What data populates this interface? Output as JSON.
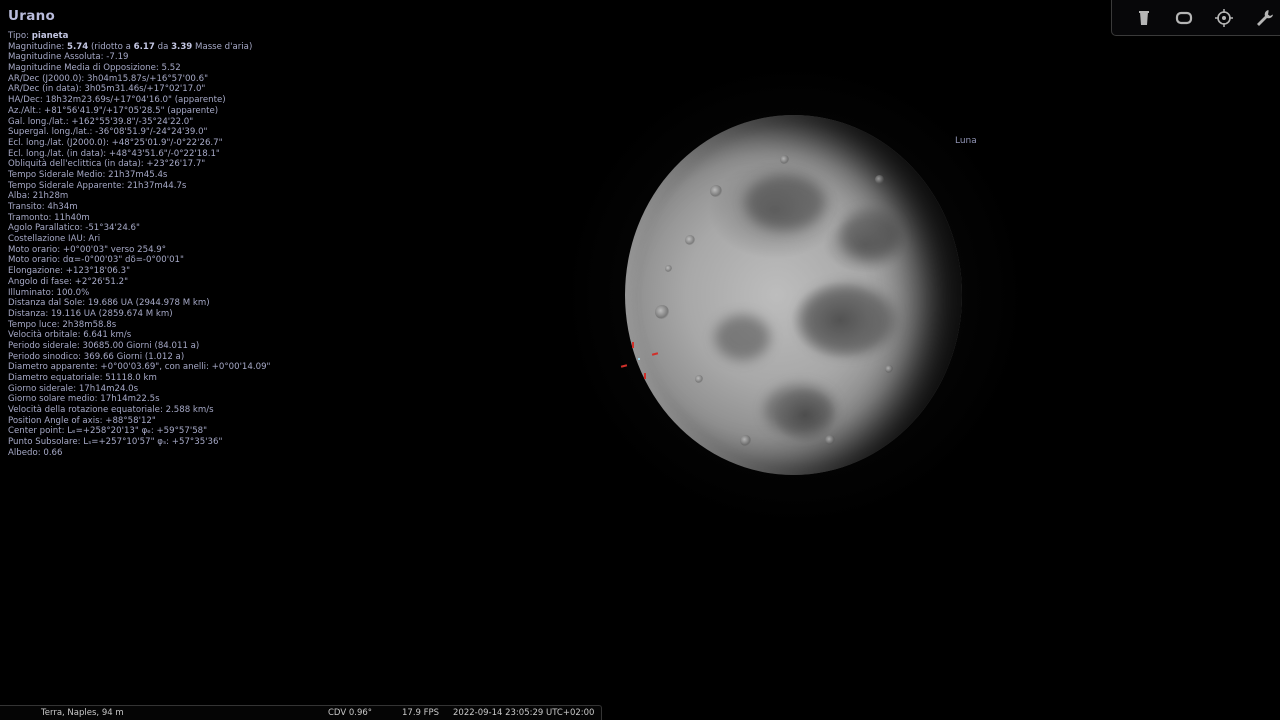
{
  "object": {
    "name": "Urano",
    "lines": [
      {
        "pre": "Tipo: ",
        "b1": "pianeta",
        "mid": "",
        "b2": "",
        "post": "",
        "b3": "",
        "end": ""
      },
      {
        "pre": "Magnitudine: ",
        "b1": "5.74",
        "mid": " (ridotto a ",
        "b2": "6.17",
        "post": " da ",
        "b3": "3.39",
        "end": " Masse d'aria)"
      },
      {
        "pre": "Magnitudine Assoluta: -7.19"
      },
      {
        "pre": "Magnitudine Media di Opposizione: 5.52"
      },
      {
        "pre": "AR/Dec (J2000.0): 3h04m15.87s/+16°57'00.6\""
      },
      {
        "pre": "AR/Dec (in data): 3h05m31.46s/+17°02'17.0\""
      },
      {
        "pre": "HA/Dec: 18h32m23.69s/+17°04'16.0\" (apparente)"
      },
      {
        "pre": "Az./Alt.: +81°56'41.9\"/+17°05'28.5\" (apparente)"
      },
      {
        "pre": "Gal. long./lat.: +162°55'39.8\"/-35°24'22.0\""
      },
      {
        "pre": "Supergal. long./lat.: -36°08'51.9\"/-24°24'39.0\""
      },
      {
        "pre": "Ecl. long./lat. (J2000.0): +48°25'01.9\"/-0°22'26.7\""
      },
      {
        "pre": "Ecl. long./lat. (in data): +48°43'51.6\"/-0°22'18.1\""
      },
      {
        "pre": "Obliquità dell'eclittica (in data): +23°26'17.7\""
      },
      {
        "pre": "Tempo Siderale Medio: 21h37m45.4s"
      },
      {
        "pre": "Tempo Siderale Apparente: 21h37m44.7s"
      },
      {
        "pre": "Alba: 21h28m"
      },
      {
        "pre": "Transito: 4h34m"
      },
      {
        "pre": "Tramonto: 11h40m"
      },
      {
        "pre": "Agolo Parallatico: -51°34'24.6\""
      },
      {
        "pre": "Costellazione IAU: Ari"
      },
      {
        "pre": "Moto orario: +0°00'03\" verso 254.9°"
      },
      {
        "pre": "Moto orario: dα=-0°00'03\" dδ=-0°00'01\""
      },
      {
        "pre": "Elongazione: +123°18'06.3\""
      },
      {
        "pre": "Angolo di fase: +2°26'51.2\""
      },
      {
        "pre": "Illuminato: 100.0%"
      },
      {
        "pre": "Distanza dal Sole: 19.686 UA (2944.978 M km)"
      },
      {
        "pre": "Distanza: 19.116 UA (2859.674 M km)"
      },
      {
        "pre": "Tempo luce: 2h38m58.8s"
      },
      {
        "pre": "Velocità orbitale: 6.641 km/s"
      },
      {
        "pre": "Periodo siderale: 30685.00 Giorni (84.011 a)"
      },
      {
        "pre": "Periodo sinodico: 369.66 Giorni (1.012 a)"
      },
      {
        "pre": "Diametro apparente: +0°00'03.69\", con anelli: +0°00'14.09\""
      },
      {
        "pre": "Diametro equatoriale: 51118.0 km"
      },
      {
        "pre": "Giorno siderale: 17h14m24.0s"
      },
      {
        "pre": "Giorno solare medio: 17h14m22.5s"
      },
      {
        "pre": "Velocità della rotazione equatoriale: 2.588 km/s"
      },
      {
        "pre": "Position Angle of axis: +88°58'12\""
      },
      {
        "pre": "Center point: Lₑ=+258°20'13\" φₑ: +59°57'58\""
      },
      {
        "pre": "Punto Subsolare: Lₛ=+257°10'57\" φₛ: +57°35'36\""
      },
      {
        "pre": "Albedo: 0.66"
      }
    ]
  },
  "sky": {
    "moon_label": "Luna"
  },
  "toolbar": {
    "buttons": [
      {
        "name": "trash-icon",
        "title": ""
      },
      {
        "name": "rounded-rect-icon",
        "title": ""
      },
      {
        "name": "target-icon",
        "title": ""
      },
      {
        "name": "wrench-icon",
        "title": ""
      }
    ]
  },
  "status": {
    "location": "Terra, Naples, 94 m",
    "fov": "CDV 0.96°",
    "fps": "17.9 FPS",
    "datetime": "2022-09-14 23:05:29 UTC+02:00"
  },
  "colors": {
    "info_text": "#a6a9c7",
    "title_text": "#b9bcdc",
    "marker": "#d0302a",
    "background": "#000000"
  }
}
